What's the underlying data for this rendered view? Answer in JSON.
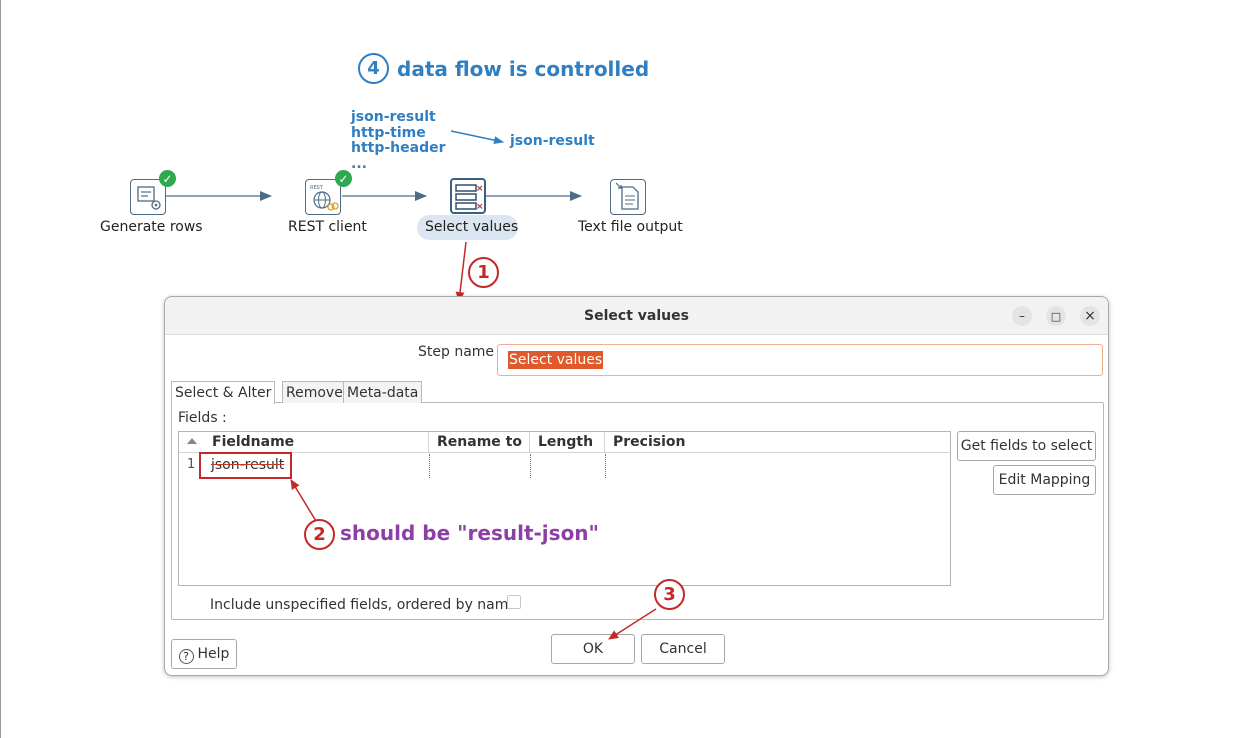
{
  "annotations": {
    "top_title_number": "4",
    "top_title": "data flow is controlled",
    "input_fields": [
      "json-result",
      "http-time",
      "http-header",
      "..."
    ],
    "output_field": "json-result",
    "marker_1": "1",
    "marker_2": "2",
    "marker_3": "3",
    "note": "should be \"result-json\""
  },
  "pipeline": {
    "steps": [
      {
        "label": "Generate rows",
        "icon": "generate-rows-icon",
        "status": "ok"
      },
      {
        "label": "REST client",
        "icon": "rest-client-icon",
        "status": "ok"
      },
      {
        "label": "Select values",
        "icon": "select-values-icon",
        "selected": true
      },
      {
        "label": "Text file output",
        "icon": "text-file-output-icon"
      }
    ]
  },
  "dialog": {
    "title": "Select values",
    "window_buttons": {
      "minimize": "–",
      "maximize": "□",
      "close": "×"
    },
    "step_name_label": "Step name",
    "step_name_value": "Select values",
    "tabs": [
      {
        "label": "Select & Alter",
        "active": true
      },
      {
        "label": "Remove"
      },
      {
        "label": "Meta-data"
      }
    ],
    "fields_label": "Fields :",
    "table": {
      "columns": [
        "Fieldname",
        "Rename to",
        "Length",
        "Precision"
      ],
      "rows": [
        {
          "num": "1",
          "fieldname": "json-result",
          "rename_to": "",
          "length": "",
          "precision": ""
        }
      ]
    },
    "get_fields_button": "Get fields to select",
    "edit_mapping_button": "Edit Mapping",
    "include_unspecified_label": "Include unspecified fields, ordered by name",
    "include_unspecified_checked": false,
    "help_button": "Help",
    "help_icon_glyph": "?",
    "ok_button": "OK",
    "cancel_button": "Cancel"
  },
  "colors": {
    "annotation_blue": "#2f7fc2",
    "annotation_red": "#c62828",
    "annotation_purple": "#8e3fa6",
    "status_ok_green": "#2fa84f",
    "selection_orange": "#e0592a"
  }
}
